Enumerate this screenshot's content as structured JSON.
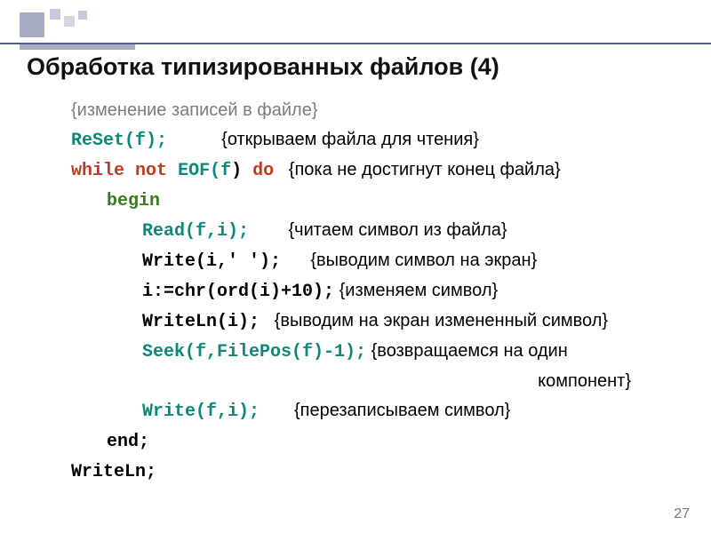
{
  "title": "Обработка типизированных файлов (4)",
  "pageNumber": "27",
  "lines": {
    "topComment": "{изменение записей в файле}",
    "reset": {
      "code": "ReSet(f);",
      "comment": "{открываем файла для чтения}"
    },
    "while": {
      "kw1": "while",
      "kw2": "not",
      "eof": "EOF(f",
      "paren": ")",
      "kw3": "do",
      "comment": "{пока не достигнут конец файла}"
    },
    "begin": "begin",
    "read": {
      "code": "Read(f,i);",
      "comment": "{читаем символ из файла}"
    },
    "write1": {
      "code": "Write(i,' ');",
      "comment": "{выводим символ на экран}"
    },
    "assign": {
      "code": "i:=chr(ord(i)+10);",
      "comment": "{изменяем символ}"
    },
    "writeln1": {
      "code": "WriteLn(i);",
      "comment": "{выводим на экран измененный символ}"
    },
    "seek": {
      "code": "Seek(f,FilePos(f)-1);",
      "comment": "{возвращаемся на один"
    },
    "seek2": {
      "comment": "компонент}"
    },
    "write2": {
      "code": "Write(f,i);",
      "comment": "{перезаписываем символ}"
    },
    "end": "end;",
    "writeln2": "WriteLn;"
  }
}
